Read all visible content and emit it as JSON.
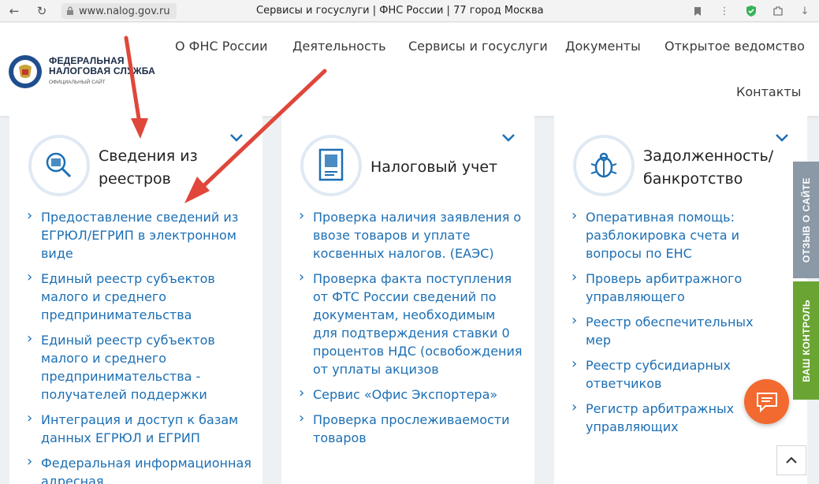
{
  "browser": {
    "url": "www.nalog.gov.ru",
    "tab_title": "Сервисы и госуслуги | ФНС России | 77 город Москва"
  },
  "logo": {
    "line1": "ФЕДЕРАЛЬНАЯ",
    "line2": "НАЛОГОВАЯ СЛУЖБА",
    "sub": "ОФИЦИАЛЬНЫЙ САЙТ"
  },
  "menu": {
    "items": [
      "О ФНС России",
      "Деятельность",
      "Сервисы и госуслуги",
      "Документы",
      "Открытое ведомство",
      "Контакты"
    ]
  },
  "cards": [
    {
      "title_line1": "Сведения из",
      "title_line2": "реестров",
      "links": [
        "Предоставление сведений из ЕГРЮЛ/ЕГРИП в электронном виде",
        "Единый реестр субъектов малого и среднего предпринимательства",
        "Единый реестр субъектов малого и среднего предпринимательства - получателей поддержки",
        "Интеграция и доступ к базам данных ЕГРЮЛ и ЕГРИП",
        "Федеральная информационная адресная"
      ]
    },
    {
      "title_line1": "Налоговый учет",
      "links": [
        "Проверка наличия заявления о ввозе товаров и уплате косвенных налогов. (ЕАЭС)",
        "Проверка факта поступления от ФТС России сведений по документам, необходимым для подтверждения ставки 0 процентов НДС (освобождения от уплаты акцизов",
        "Сервис «Офис Экспортера»",
        "Проверка прослеживаемости товаров"
      ]
    },
    {
      "title_line1": "Задолженность/",
      "title_line2": "банкротство",
      "links": [
        "Оперативная помощь: разблокировка счета и вопросы по ЕНС",
        "Проверь арбитражного управляющего",
        "Реестр обеспечительных мер",
        "Реестр субсидиарных ответчиков",
        "Регистр арбитражных управляющих"
      ]
    }
  ],
  "side_tabs": {
    "feedback": "ОТЗЫВ О САЙТЕ",
    "control": "ВАШ КОНТРОЛЬ"
  },
  "colors": {
    "link": "#1c6fb4",
    "accent_orange": "#f26a2f",
    "annotation_arrow": "#e0463a",
    "side_gray": "#8b98a6",
    "side_green": "#6aa534"
  }
}
